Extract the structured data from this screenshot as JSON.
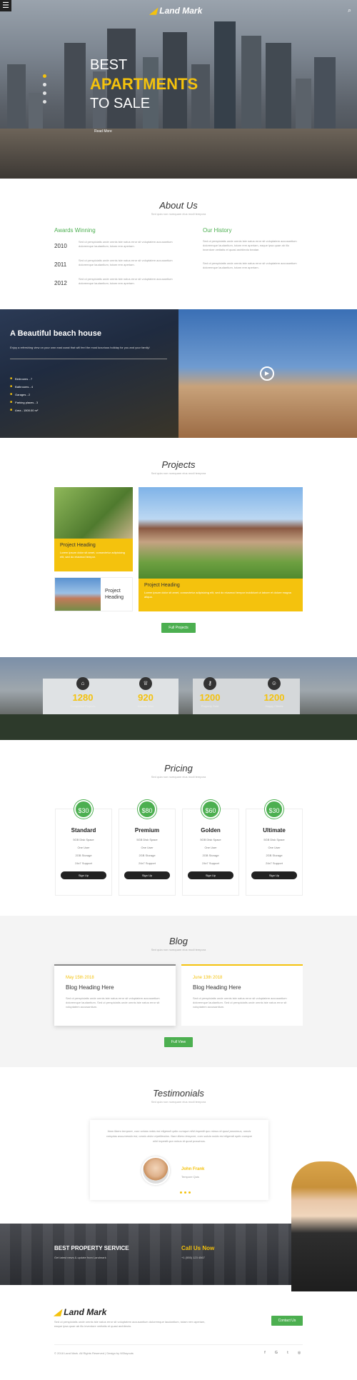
{
  "header": {
    "menu_icon": "menu-icon",
    "logo": "Land Mark",
    "search_icon": "search-icon"
  },
  "hero": {
    "line1": "BEST",
    "line2": "APARTMENTS",
    "line3": "TO SALE",
    "read_more": "Read More"
  },
  "about": {
    "title": "About Us",
    "subtitle": "Sed quia non numquam eius modi tempora",
    "awards_title": "Awards Winning",
    "awards": [
      {
        "year": "2010",
        "text": "Sed ut perspiciatis unde omnis iste natus error sit voluptatem accusantium doloremque laudantium, totam rem aperiam."
      },
      {
        "year": "2011",
        "text": "Sed ut perspiciatis unde omnis iste natus error sit voluptatem accusantium doloremque laudantium, totam rem aperiam."
      },
      {
        "year": "2012",
        "text": "Sed ut perspiciatis unde omnis iste natus error sit voluptatem accusantium doloremque laudantium, totam rem aperiam."
      }
    ],
    "history_title": "Our History",
    "history_p1": "Sed ut perspiciatis unde omnis iste natus error sit voluptatem accusantium doloremque laudantium, totam rem aperiam, eaque ipsa quae ab illo inventore veritatis et quasi architecto beatae.",
    "history_p2": "Sed ut perspiciatis unde omnis iste natus error sit voluptatem accusantium doloremque laudantium, totam rem aperiam."
  },
  "beach": {
    "title": "A Beautiful beach house",
    "desc": "Enjoy a refreshing view on your own east coast that will feel the most luxurious holiday for you and your family!",
    "features": [
      {
        "icon": "bed-icon",
        "label": "Bedrooms - 7"
      },
      {
        "icon": "bath-icon",
        "label": "Bathrooms - 4"
      },
      {
        "icon": "car-icon",
        "label": "Garages - 2"
      },
      {
        "icon": "parking-icon",
        "label": "Parking places - 3"
      },
      {
        "icon": "area-icon",
        "label": "Area - 1500.00 m²"
      }
    ]
  },
  "projects": {
    "title": "Projects",
    "subtitle": "Sed quia non numquam eius modi tempora",
    "card1_heading": "Project Heading",
    "card1_text": "Lorem ipsum dolor sit amet, consectetur adipisicing elit, sed do eiusmod tempor.",
    "card2_heading": "Project Heading",
    "card3_heading": "Project Heading",
    "card3_text": "Lorem ipsum dolor sit amet, consectetur adipisicing elit, sed do eiusmod tempor incididunt ut labore et dolore magna aliqua.",
    "button": "Full Projects"
  },
  "stats": [
    {
      "icon": "home-icon",
      "number": "1280",
      "label": "Completed Projects"
    },
    {
      "icon": "trophy-icon",
      "number": "920",
      "label": "Awards Won"
    },
    {
      "icon": "key-icon",
      "number": "1200",
      "label": "Property Sold"
    },
    {
      "icon": "smile-icon",
      "number": "1200",
      "label": "Happy Clients"
    }
  ],
  "pricing": {
    "title": "Pricing",
    "subtitle": "Sed quia non numquam eius modi tempora",
    "plans": [
      {
        "price": "$30",
        "name": "Standard",
        "items": [
          "5GB Disk Space",
          "One User",
          "2GB Storage",
          "24x7 Support"
        ],
        "button": "Sign Up"
      },
      {
        "price": "$80",
        "name": "Premium",
        "items": [
          "5GB Disk Space",
          "One User",
          "2GB Storage",
          "24x7 Support"
        ],
        "button": "Sign Up"
      },
      {
        "price": "$60",
        "name": "Golden",
        "items": [
          "5GB Disk Space",
          "One User",
          "2GB Storage",
          "24x7 Support"
        ],
        "button": "Sign Up"
      },
      {
        "price": "$30",
        "name": "Ultimate",
        "items": [
          "5GB Disk Space",
          "One User",
          "2GB Storage",
          "24x7 Support"
        ],
        "button": "Sign Up"
      }
    ]
  },
  "blog": {
    "title": "Blog",
    "subtitle": "Sed quia non numquam eius modi tempora",
    "posts": [
      {
        "date": "May 15th 2018",
        "heading": "Blog Heading Here",
        "text": "Sed ut perspiciatis unde omnis iste natus error sit voluptatem accusantium doloremque laudantium. Sed ut perspiciatis unde omnis iste natus error sit voluptatem accusantium."
      },
      {
        "date": "June 13th 2018",
        "heading": "Blog Heading Here",
        "text": "Sed ut perspiciatis unde omnis iste natus error sit voluptatem accusantium doloremque laudantium. Sed ut perspiciatis unde omnis iste natus error sit voluptatem accusantium."
      }
    ],
    "button": "Full View"
  },
  "testimonials": {
    "title": "Testimonials",
    "subtitle": "Sed quia non numquam eius modi tempora",
    "quote": "Nam libero tempore, cum soluta nobis est eligendi optio cumque nihil impedit quo minus id quod possimus, omnis voluptas assumenda est, omnis dolor repellendus. Nam libero tempore, cum soluta nobis est eligendi optio cumque nihil impedit quo minus id quod possimus.",
    "name": "John Frank",
    "role": "Tempore Quis"
  },
  "cta": {
    "left_title": "BEST PROPERTY SERVICE",
    "left_text": "Get latest news & update from Landmark",
    "right_title": "Call Us Now",
    "right_text": "+1 (555) 123 4567"
  },
  "footer": {
    "logo": "Land Mark",
    "desc": "Sed ut perspiciatis unde omnis iste natus error sit voluptatem accusantium doloremque laudantium, totam rem aperiam, eaque ipsa quae ab illo inventore veritatis et quasi architecto.",
    "contact": "Contact Us",
    "copyright": "© 2018 Land Mark. All Rights Reserved | Design by W3layouts",
    "social": [
      "facebook-icon",
      "google-plus-icon",
      "twitter-icon",
      "dribbble-icon"
    ]
  },
  "colors": {
    "accent": "#f4c20d",
    "green": "#4caf50",
    "dark": "#222222"
  }
}
